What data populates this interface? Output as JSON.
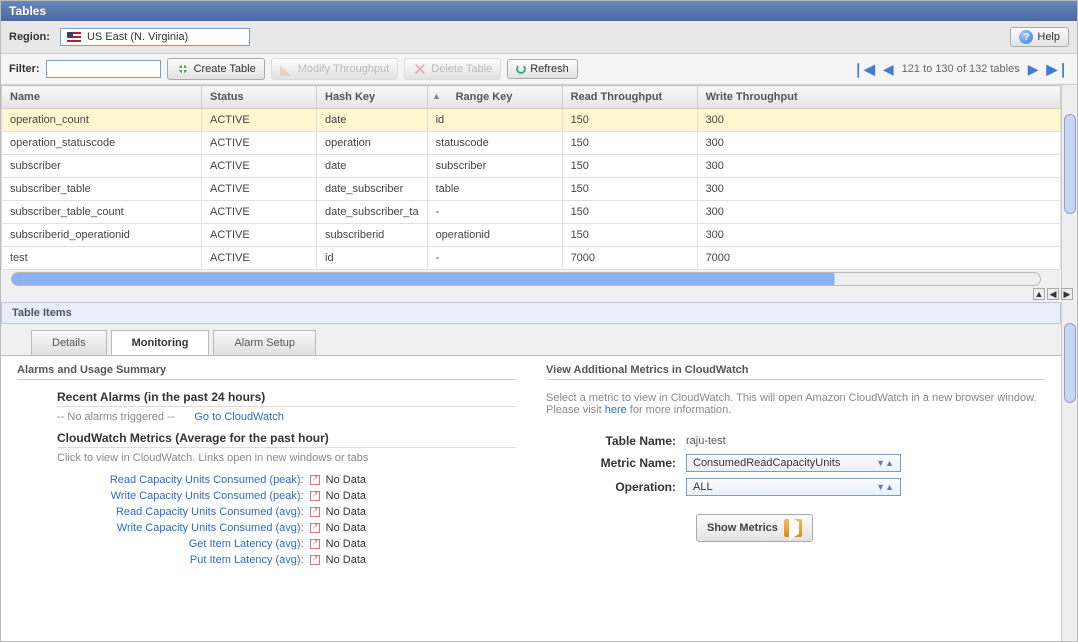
{
  "title_bar": "Tables",
  "region": {
    "label": "Region:",
    "value": "US East (N. Virginia)"
  },
  "help_label": "Help",
  "toolbar": {
    "filter_label": "Filter:",
    "filter_value": "",
    "create_label": "Create Table",
    "modify_label": "Modify Throughput",
    "delete_label": "Delete Table",
    "refresh_label": "Refresh"
  },
  "pager": {
    "text": "121 to 130 of 132 tables"
  },
  "columns": {
    "name": "Name",
    "status": "Status",
    "hash": "Hash Key",
    "range": "Range Key",
    "read": "Read Throughput",
    "write": "Write Throughput"
  },
  "rows": [
    {
      "name": "operation_count",
      "status": "ACTIVE",
      "hash": "date",
      "range": "id",
      "read": "150",
      "write": "300",
      "selected": true
    },
    {
      "name": "operation_statuscode",
      "status": "ACTIVE",
      "hash": "operation",
      "range": "statuscode",
      "read": "150",
      "write": "300"
    },
    {
      "name": "subscriber",
      "status": "ACTIVE",
      "hash": "date",
      "range": "subscriber",
      "read": "150",
      "write": "300"
    },
    {
      "name": "subscriber_table",
      "status": "ACTIVE",
      "hash": "date_subscriber",
      "range": "table",
      "read": "150",
      "write": "300"
    },
    {
      "name": "subscriber_table_count",
      "status": "ACTIVE",
      "hash": "date_subscriber_ta",
      "range": "-",
      "read": "150",
      "write": "300"
    },
    {
      "name": "subscriberid_operationid",
      "status": "ACTIVE",
      "hash": "subscriberid",
      "range": "operationid",
      "read": "150",
      "write": "300"
    },
    {
      "name": "test",
      "status": "ACTIVE",
      "hash": "id",
      "range": "-",
      "read": "7000",
      "write": "7000"
    }
  ],
  "panel_title": "Table Items",
  "tabs": {
    "details": "Details",
    "monitoring": "Monitoring",
    "alarm": "Alarm Setup"
  },
  "left": {
    "section": "Alarms and Usage Summary",
    "recent_header": "Recent Alarms (in the past 24 hours)",
    "no_alarms": "-- No alarms triggered --",
    "go_cw": "Go to CloudWatch",
    "cw_header": "CloudWatch Metrics (Average for the past hour)",
    "cw_hint": "Click to view in CloudWatch. Links open in new windows or tabs",
    "no_data": "No Data",
    "metrics": [
      "Read Capacity Units Consumed (peak):",
      "Write Capacity Units Consumed (peak):",
      "Read Capacity Units Consumed (avg):",
      "Write Capacity Units Consumed (avg):",
      "Get Item Latency (avg):",
      "Put Item Latency (avg):"
    ]
  },
  "right": {
    "section": "View Additional Metrics in CloudWatch",
    "hint_pre": "Select a metric to view in CloudWatch. This will open Amazon CloudWatch in a new browser window. Please visit ",
    "hint_link": "here",
    "hint_post": " for more information.",
    "table_label": "Table Name:",
    "table_value": "raju-test",
    "metric_label": "Metric Name:",
    "metric_value": "ConsumedReadCapacityUnits",
    "op_label": "Operation:",
    "op_value": "ALL",
    "show_label": "Show Metrics"
  }
}
